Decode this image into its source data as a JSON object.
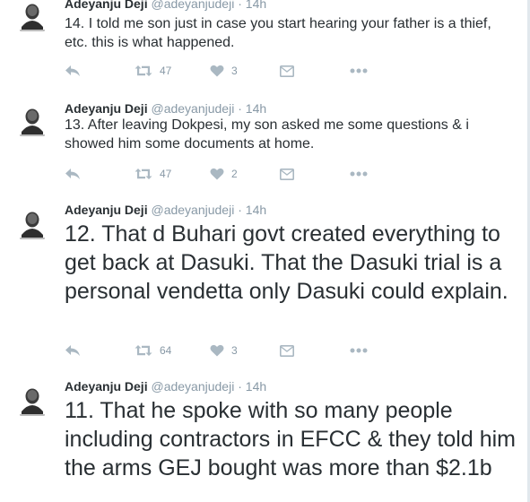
{
  "tweets": [
    {
      "name": "Adeyanju Deji",
      "handle": "@adeyanjudeji",
      "time": "14h",
      "text": "14. I told me son just in case you start hearing your father is a thief, etc. this is what happened.",
      "retweets": "47",
      "likes": "3"
    },
    {
      "name": "Adeyanju Deji",
      "handle": "@adeyanjudeji",
      "time": "14h",
      "text": "13. After leaving Dokpesi, my son asked me some questions & i showed him some documents at home.",
      "retweets": "47",
      "likes": "2"
    },
    {
      "name": "Adeyanju Deji",
      "handle": "@adeyanjudeji",
      "time": "14h",
      "text": "12. That d Buhari govt created everything to get back at Dasuki. That the Dasuki trial is a personal vendetta only Dasuki could explain.",
      "retweets": "64",
      "likes": "3"
    },
    {
      "name": "Adeyanju Deji",
      "handle": "@adeyanjudeji",
      "time": "14h",
      "text": "11. That he spoke with so many people including contractors in EFCC & they told him the arms GEJ bought was more than $2.1b",
      "retweets": "",
      "likes": ""
    }
  ],
  "separator": "·",
  "icons": {
    "reply": "reply-icon",
    "retweet": "retweet-icon",
    "like": "heart-icon",
    "dm": "envelope-icon",
    "more": "more-icon"
  },
  "colors": {
    "action_gray": "#aab8c2",
    "meta_gray": "#8899a6",
    "text": "#292f33",
    "border": "#e1e8ed"
  }
}
